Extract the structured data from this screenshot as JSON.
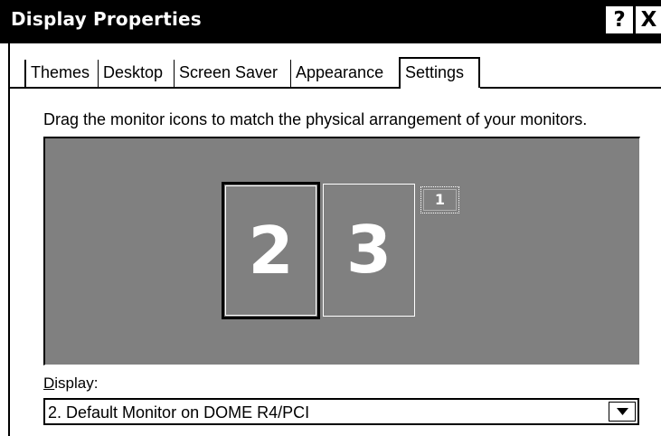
{
  "window": {
    "title": "Display Properties",
    "help_glyph": "?",
    "close_glyph": "X"
  },
  "tabs": [
    {
      "label": "Themes",
      "active": false
    },
    {
      "label": "Desktop",
      "active": false
    },
    {
      "label": "Screen Saver",
      "active": false
    },
    {
      "label": "Appearance",
      "active": false
    },
    {
      "label": "Settings",
      "active": true
    }
  ],
  "settings": {
    "instruction": "Drag the monitor icons to match the physical arrangement of your monitors.",
    "monitors": [
      {
        "number": "2",
        "selected": true
      },
      {
        "number": "3",
        "selected": false
      },
      {
        "number": "1",
        "selected": false
      }
    ],
    "display_label_accel": "D",
    "display_label_rest": "isplay:",
    "display_value": "2. Default Monitor on DOME R4/PCI",
    "dropdown_icon": "triangle-down"
  },
  "colors": {
    "titlebar": "#000000",
    "arrange_background": "#808080",
    "monitor_text": "#ffffff"
  }
}
